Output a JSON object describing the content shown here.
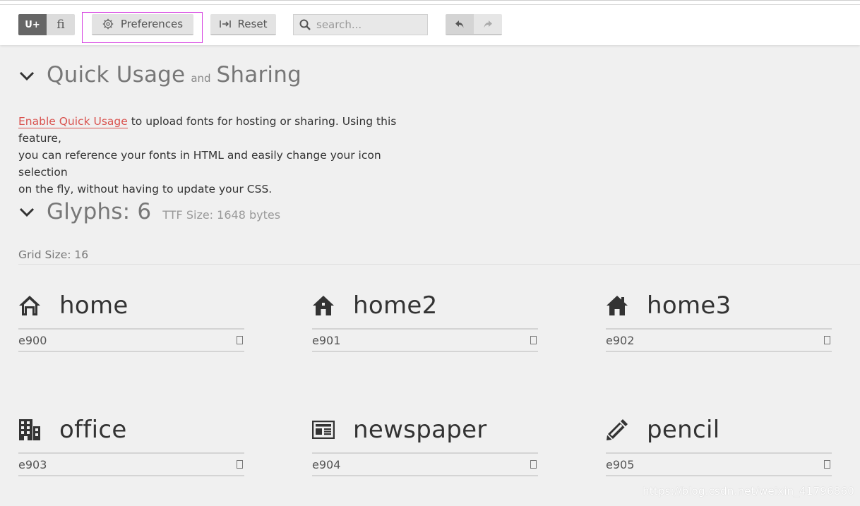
{
  "toolbar": {
    "unicode_toggle": "U+",
    "ligature_toggle": "ﬁ",
    "preferences_label": "Preferences",
    "reset_label": "Reset",
    "search_placeholder": "search..."
  },
  "quick_usage": {
    "title_part1": "Quick Usage",
    "title_and": "and",
    "title_part2": "Sharing",
    "link_text": "Enable Quick Usage",
    "text_line1": " to upload fonts for hosting or sharing. Using this feature,",
    "text_line2": "you can reference your fonts in HTML and easily change your icon selection",
    "text_line3": "on the fly, without having to update your CSS."
  },
  "glyphs": {
    "title": "Glyphs: 6",
    "ttf_size": "TTF Size: 1648 bytes",
    "grid_size": "Grid Size: 16",
    "items": [
      {
        "name": "home",
        "code": "e900",
        "icon": "home-icon"
      },
      {
        "name": "home2",
        "code": "e901",
        "icon": "home2-icon"
      },
      {
        "name": "home3",
        "code": "e902",
        "icon": "home3-icon"
      },
      {
        "name": "office",
        "code": "e903",
        "icon": "office-icon"
      },
      {
        "name": "newspaper",
        "code": "e904",
        "icon": "newspaper-icon"
      },
      {
        "name": "pencil",
        "code": "e905",
        "icon": "pencil-icon"
      }
    ]
  },
  "watermark": "https://blog.csdn.net/weixin_41796860",
  "colors": {
    "link": "#d9534f",
    "highlight_border": "#d53fe0",
    "toggle_active": "#666666"
  }
}
